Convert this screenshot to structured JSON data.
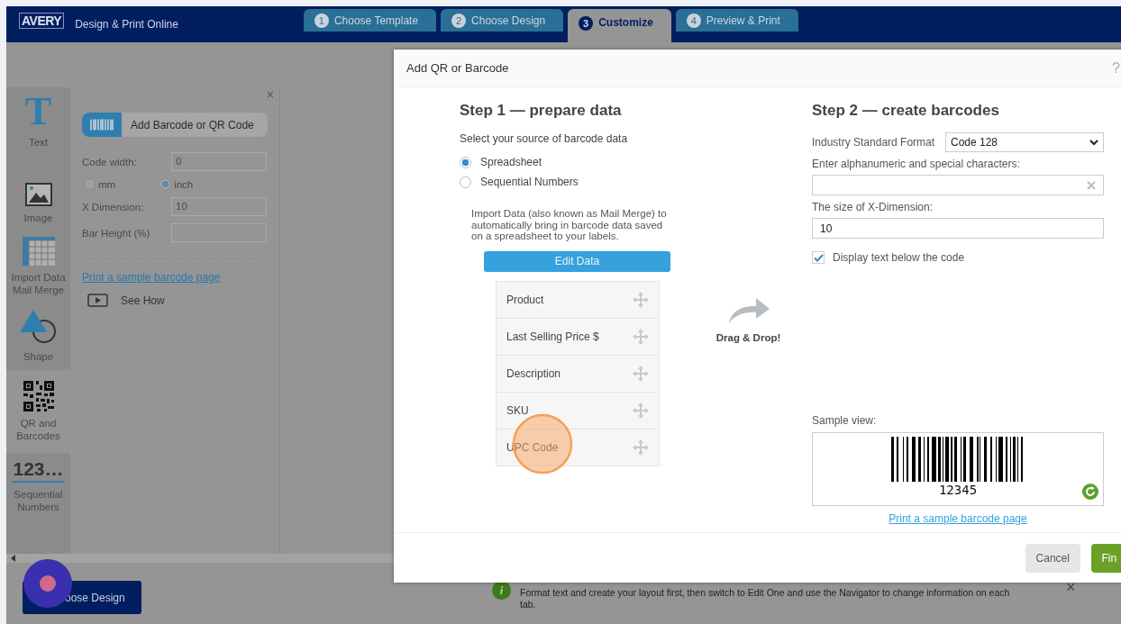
{
  "header": {
    "logo": "AVERY",
    "subtitle": "Design & Print Online"
  },
  "steps": [
    {
      "number": "1",
      "label": "Choose Template",
      "selected": false
    },
    {
      "number": "2",
      "label": "Choose Design",
      "selected": false
    },
    {
      "number": "3",
      "label": "Customize",
      "selected": true
    },
    {
      "number": "4",
      "label": "Preview & Print",
      "selected": false
    }
  ],
  "tools": [
    {
      "kind": "text",
      "glyph": "T",
      "label": "Text",
      "selected": false
    },
    {
      "kind": "image",
      "label": "Image",
      "selected": false
    },
    {
      "kind": "table",
      "label": "Import Data Mail Merge",
      "selected": false
    },
    {
      "kind": "shape",
      "label": "Shape",
      "selected": false
    },
    {
      "kind": "qr",
      "label": "QR and Barcodes",
      "selected": true
    },
    {
      "kind": "numbers",
      "glyph": "123…",
      "label": "Sequential Numbers",
      "selected": false
    }
  ],
  "panel": {
    "close": "×",
    "add_button": "Add Barcode or QR Code",
    "form": [
      {
        "kind": "field",
        "label": "Code width:",
        "value": "0"
      },
      {
        "kind": "units",
        "options": [
          {
            "label": "mm",
            "selected": false
          },
          {
            "label": "inch",
            "selected": true
          }
        ]
      },
      {
        "kind": "field",
        "label": "X Dimension:",
        "value": "10"
      },
      {
        "kind": "field",
        "label": "Bar Height (%)"
      }
    ],
    "link": "Print a sample barcode page",
    "see_how": "See How"
  },
  "bottom": {
    "nav_button": "oose Design",
    "tip": {
      "icon": "i",
      "text": "Format text and create your layout first, then switch to Edit One and use the Navigator to change information on each tab.",
      "close": "×"
    }
  },
  "dialog": {
    "title": "Add QR or Barcode",
    "help": "?",
    "step1": {
      "title": "Step 1 — prepare data",
      "prompt": "Select your source of barcode data",
      "sources": [
        {
          "label": "Spreadsheet",
          "selected": true
        },
        {
          "label": "Sequential Numbers",
          "selected": false
        }
      ],
      "description": "Import Data (also known as Mail Merge) to automatically bring in barcode data saved on a spreadsheet to your labels.",
      "edit_button": "Edit Data",
      "columns": [
        "Product",
        "Last Selling Price $",
        "Description",
        "SKU",
        "UPC Code"
      ]
    },
    "drag_label": "Drag & Drop!",
    "step2": {
      "title": "Step 2 — create barcodes",
      "format_label": "Industry Standard Format",
      "format_value": "Code 128",
      "chars_label": "Enter alphanumeric and special characters:",
      "size_label": "The size of X-Dimension:",
      "size_value": "10",
      "display_text": {
        "label": "Display text below the code",
        "checked": true
      },
      "sample_label": "Sample view:",
      "sample_code": "12345",
      "link": "Print a sample barcode page"
    },
    "buttons": {
      "cancel": "Cancel",
      "finish": "Fin"
    }
  }
}
